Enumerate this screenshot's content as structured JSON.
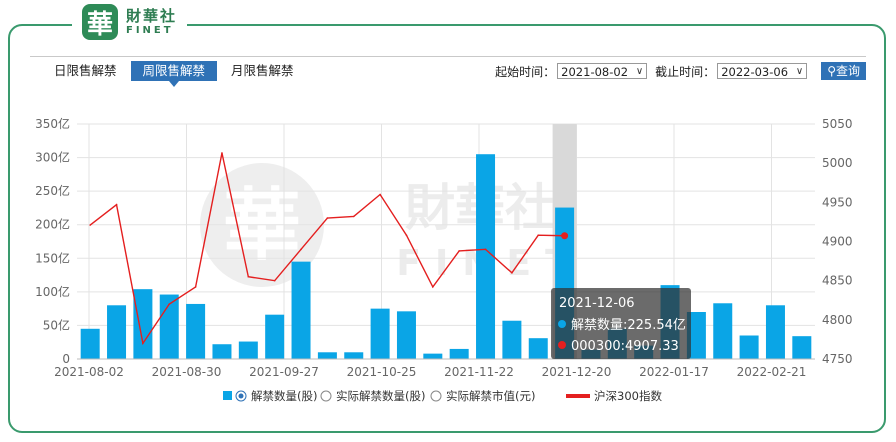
{
  "brand": {
    "seal": "華",
    "cn": "財華社",
    "en": "FINET"
  },
  "tabs": [
    {
      "label": "日限售解禁"
    },
    {
      "label": "周限售解禁"
    },
    {
      "label": "月限售解禁"
    }
  ],
  "filters": {
    "start_label": "起始时间：",
    "start_value": "2021-08-02",
    "end_label": "截止时间：",
    "end_value": "2022-03-06",
    "query_label": "查询"
  },
  "colors": {
    "bar": "#0aa5e6",
    "line": "#e41f1f",
    "accent": "#2f72b6",
    "frame": "#3a9a6d"
  },
  "chart_data": {
    "type": "bar",
    "xtick_labels": [
      "2021-08-02",
      "2021-08-30",
      "2021-09-27",
      "2021-10-25",
      "2021-11-22",
      "2021-12-20",
      "2022-01-17",
      "2022-02-21"
    ],
    "ytick_left": [
      "0",
      "50亿",
      "100亿",
      "150亿",
      "200亿",
      "250亿",
      "300亿",
      "350亿"
    ],
    "ytick_right": [
      "4750",
      "4800",
      "4850",
      "4900",
      "4950",
      "5000",
      "5050"
    ],
    "ylim_left": [
      0,
      350
    ],
    "ylim_right": [
      4750,
      5050
    ],
    "series": [
      {
        "name": "解禁数量(股)",
        "type": "bar",
        "unit": "亿",
        "values": [
          45,
          80,
          104,
          96,
          82,
          22,
          26,
          66,
          145,
          10,
          10,
          75,
          71,
          8,
          15,
          305,
          57,
          31,
          225.54,
          14,
          45,
          20,
          110,
          70,
          83,
          35,
          80,
          34
        ]
      },
      {
        "name": "沪深300指数",
        "type": "line",
        "values": [
          4921,
          4947,
          4770,
          4820,
          4842,
          5013,
          4855,
          4850,
          4890,
          4930,
          4932,
          4960,
          4908,
          4842,
          4888,
          4890,
          4860,
          4908,
          4907.33
        ]
      }
    ],
    "legend": [
      {
        "label": "解禁数量(股)",
        "selected": true
      },
      {
        "label": "实际解禁数量(股)",
        "selected": false
      },
      {
        "label": "实际解禁市值(元)",
        "selected": false
      },
      {
        "label": "沪深300指数"
      }
    ],
    "tooltip": {
      "date": "2021-12-06",
      "bar_label": "解禁数量:225.54亿",
      "line_label": "000300:4907.33"
    },
    "hover_index": 18
  }
}
